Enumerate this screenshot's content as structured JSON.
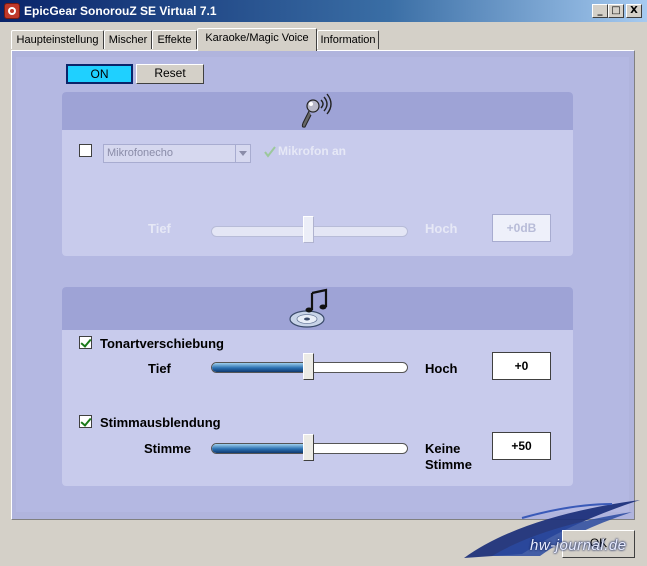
{
  "window": {
    "title": "EpicGear SonorouZ SE Virtual 7.1",
    "minimize": "_",
    "maximize": "□",
    "close": "X"
  },
  "tabs": [
    {
      "label": "Haupteinstellung"
    },
    {
      "label": "Mischer"
    },
    {
      "label": "Effekte"
    },
    {
      "label": "Karaoke/Magic Voice",
      "active": true
    },
    {
      "label": "Information"
    }
  ],
  "controls": {
    "on_label": "ON",
    "reset_label": "Reset",
    "on_color": "#1fd0ff"
  },
  "microphone_section": {
    "icon": "microphone-icon",
    "echo_select": {
      "value": "Mikrofonecho",
      "enabled": false
    },
    "echo_checkbox_checked": false,
    "mic_on_label": "Mikrofon an",
    "slider": {
      "left_label": "Tief",
      "right_label": "Hoch",
      "value_text": "+0dB",
      "level": 0.5,
      "enabled": false
    }
  },
  "music_section": {
    "icon": "music-cd-icon",
    "key_shift": {
      "checkbox_label": "Tonartverschiebung",
      "checked": true,
      "left_label": "Tief",
      "right_label": "Hoch",
      "value_text": "+0",
      "level": 0.5
    },
    "voice_fade": {
      "checkbox_label": "Stimmausblendung",
      "checked": true,
      "left_label": "Stimme",
      "right_label_line1": "Keine",
      "right_label_line2": "Stimme",
      "value_text": "+50",
      "level": 0.5
    }
  },
  "footer": {
    "ok_label": "OK",
    "watermark": "hw-journal.de"
  }
}
